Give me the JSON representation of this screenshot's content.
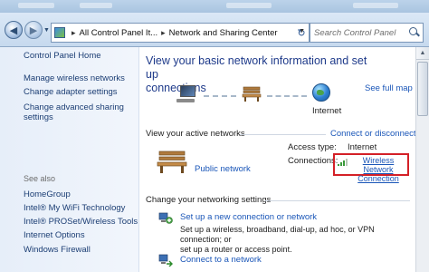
{
  "toolbar": {
    "breadcrumb": [
      "All Control Panel It...",
      "Network and Sharing Center"
    ],
    "search_placeholder": "Search Control Panel"
  },
  "sidebar": {
    "items": [
      {
        "label": "Control Panel Home"
      },
      {
        "label": "Manage wireless networks"
      },
      {
        "label": "Change adapter settings"
      },
      {
        "label": "Change advanced sharing"
      },
      {
        "label": "settings"
      }
    ],
    "see_also_title": "See also",
    "see_also": [
      {
        "label": "HomeGroup"
      },
      {
        "label": "Intel® My WiFi Technology"
      },
      {
        "label": "Intel® PROSet/Wireless Tools"
      },
      {
        "label": "Internet Options"
      },
      {
        "label": "Windows Firewall"
      }
    ]
  },
  "main": {
    "heading_line1": "View your basic network information and set up",
    "heading_line2": "connections",
    "see_full_map": "See full map",
    "internet_label": "Internet",
    "active_networks_title": "View your active networks",
    "connect_disconnect": "Connect or disconnect",
    "network_name": "Public network",
    "access_type_label": "Access type:",
    "access_type_value": "Internet",
    "connections_label": "Connections:",
    "connection_link_line1": "Wireless Network",
    "connection_link_line2": "Connection",
    "change_settings_title": "Change your networking settings",
    "tasks": [
      {
        "label": "Set up a new connection or network",
        "desc_line1": "Set up a wireless, broadband, dial-up, ad hoc, or VPN connection; or",
        "desc_line2": "set up a router or access point."
      },
      {
        "label": "Connect to a network"
      }
    ]
  },
  "colors": {
    "link": "#1a56b8",
    "heading": "#1e3a8a",
    "highlight_box": "#d42027",
    "sidebar_bg": "#e6eef9"
  },
  "icons": [
    "back-arrow-icon",
    "forward-arrow-icon",
    "control-panel-icon",
    "refresh-icon",
    "search-icon",
    "computer-icon",
    "bench-icon",
    "globe-icon",
    "signal-bars-icon",
    "network-setup-icon"
  ]
}
